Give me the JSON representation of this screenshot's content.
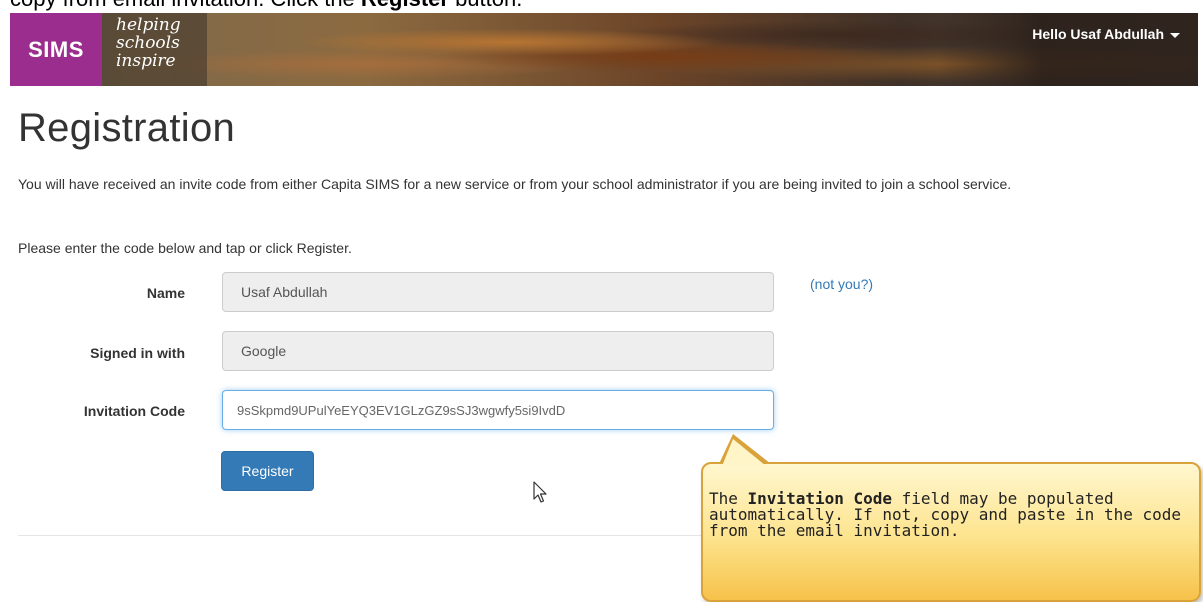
{
  "caption": {
    "pre": "copy from email invitation. Click the ",
    "button_name": "Register",
    "post": " button."
  },
  "header": {
    "logo": "SIMS",
    "tagline": [
      "helping",
      "schools",
      "inspire"
    ],
    "user_greeting": "Hello Usaf Abdullah"
  },
  "page": {
    "title": "Registration",
    "intro": "You will have received an invite code from either Capita SIMS for a new service or from your school administrator if you are being invited to join a school service.",
    "instruction": "Please enter the code below and tap or click Register."
  },
  "form": {
    "name_label": "Name",
    "name_value": "Usaf Abdullah",
    "not_you": "(not you?)",
    "signed_in_label": "Signed in with",
    "signed_in_value": "Google",
    "code_label": "Invitation Code",
    "code_value": "9sSkpmd9UPulYeEYQ3EV1GLzGZ9sSJ3wgwfy5si9IvdD",
    "register_label": "Register"
  },
  "callout": {
    "pre": "The ",
    "bold": "Invitation Code",
    "post": " field may be populated automatically. If not, copy and paste in the code from the email invitation."
  },
  "colors": {
    "brand": "#9b2d8e",
    "primary": "#337ab7",
    "callout": "#fde38c"
  }
}
